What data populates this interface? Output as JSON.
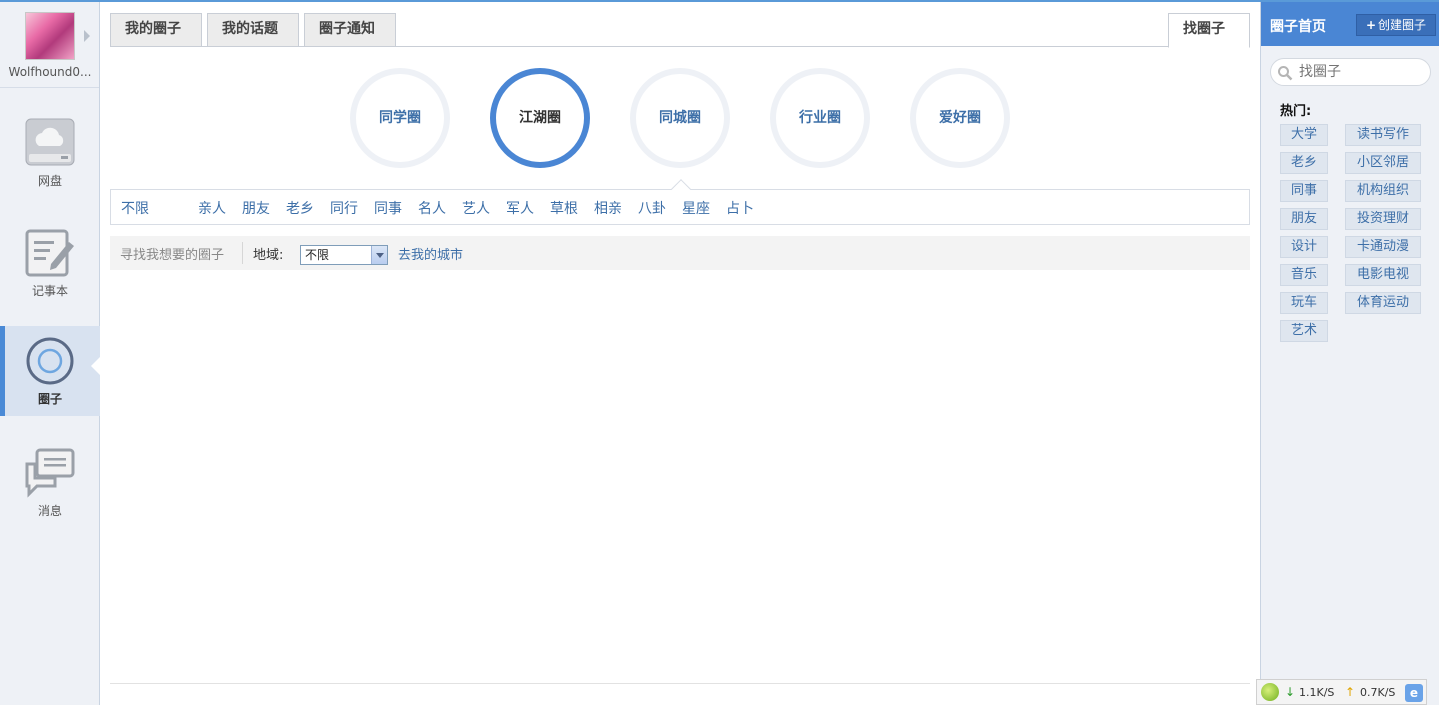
{
  "sidebar": {
    "username": "Wolfhound0...",
    "items": [
      {
        "label": "网盘",
        "icon": "cloud-disk-icon"
      },
      {
        "label": "记事本",
        "icon": "notepad-icon"
      },
      {
        "label": "圈子",
        "icon": "circle-icon"
      },
      {
        "label": "消息",
        "icon": "message-icon"
      }
    ],
    "active_item": "圈子",
    "accent_color": "#4a86d4"
  },
  "tabs": {
    "my_circles": "我的圈子",
    "my_topics": "我的话题",
    "notices": "圈子通知",
    "find": "找圈子"
  },
  "categories": [
    {
      "label": "同学圈",
      "active": false
    },
    {
      "label": "江湖圈",
      "active": true
    },
    {
      "label": "同城圈",
      "active": false
    },
    {
      "label": "行业圈",
      "active": false
    },
    {
      "label": "爱好圈",
      "active": false
    }
  ],
  "sub_filters": [
    "不限",
    "亲人",
    "朋友",
    "老乡",
    "同行",
    "同事",
    "名人",
    "艺人",
    "军人",
    "草根",
    "相亲",
    "八卦",
    "星座",
    "占卜"
  ],
  "search_bar": {
    "hint": "寻找我想要的圈子",
    "region_label": "地域:",
    "region_value": "不限",
    "go_city": "去我的城市"
  },
  "right_panel": {
    "title": "圈子首页",
    "create_plus": "+",
    "create_label": "创建圈子",
    "search_placeholder": "找圈子",
    "hot_label": "热门:",
    "hot_tags_left": [
      "大学",
      "老乡",
      "同事",
      "朋友",
      "设计",
      "音乐",
      "玩车",
      "艺术"
    ],
    "hot_tags_right": [
      "读书写作",
      "小区邻居",
      "机构组织",
      "投资理财",
      "卡通动漫",
      "电影电视",
      "体育运动"
    ]
  },
  "statusbar": {
    "down_arrow": "↓",
    "down_speed": "1.1K/S",
    "up_arrow": "↑",
    "up_speed": "0.7K/S",
    "ie_glyph": "e"
  }
}
